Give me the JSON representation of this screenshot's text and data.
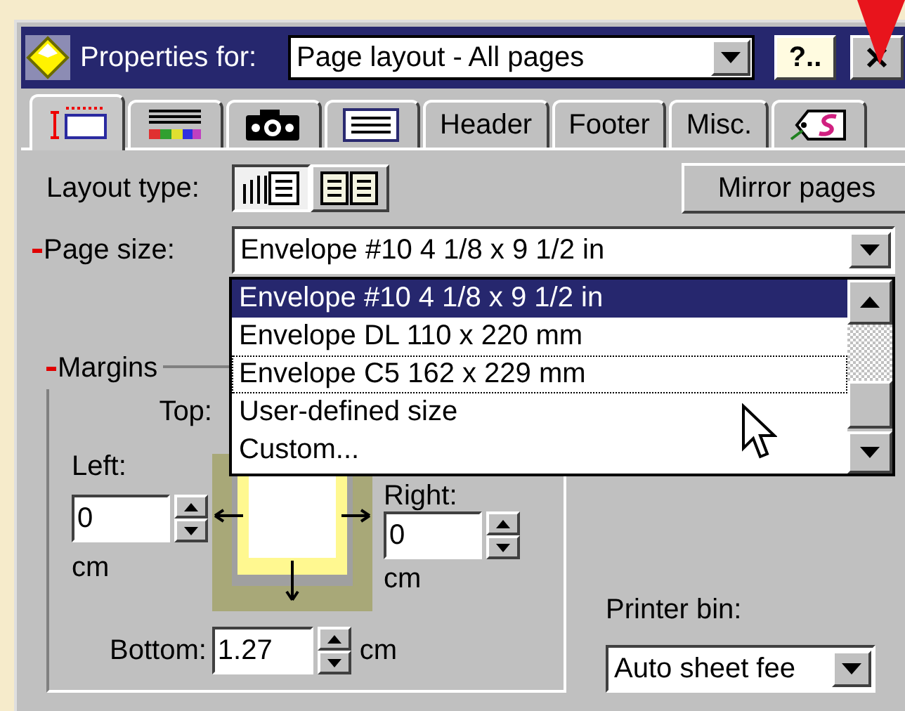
{
  "title_bar": {
    "label": "Properties for:",
    "selector": "Page layout - All pages",
    "help": "?.."
  },
  "tabs": [
    {
      "kind": "icon",
      "selected": true
    },
    {
      "kind": "icon",
      "selected": false
    },
    {
      "kind": "icon",
      "selected": false
    },
    {
      "kind": "icon",
      "selected": false
    },
    {
      "kind": "text",
      "label": "Header",
      "selected": false
    },
    {
      "kind": "text",
      "label": "Footer",
      "selected": false
    },
    {
      "kind": "text",
      "label": "Misc.",
      "selected": false
    },
    {
      "kind": "icon",
      "selected": false
    }
  ],
  "layout_type": {
    "label": "Layout type:",
    "options": [
      {
        "selected": true
      },
      {
        "selected": false
      }
    ]
  },
  "mirror_button": "Mirror pages",
  "page_size": {
    "label": "Page size:",
    "marked": true,
    "value": "Envelope #10 4 1/8 x 9 1/2 in",
    "options": [
      {
        "label": "Envelope #10 4 1/8 x 9 1/2 in",
        "selected": true,
        "focused": false
      },
      {
        "label": "Envelope DL 110 x 220 mm",
        "selected": false,
        "focused": false
      },
      {
        "label": "Envelope C5 162 x 229 mm",
        "selected": false,
        "focused": true
      },
      {
        "label": "User-defined size",
        "selected": false,
        "focused": false
      },
      {
        "label": "Custom...",
        "selected": false,
        "focused": false
      }
    ]
  },
  "margins": {
    "label": "Margins",
    "marked": true,
    "top": {
      "label": "Top:"
    },
    "left": {
      "label": "Left:",
      "value": "0",
      "unit": "cm"
    },
    "right": {
      "label": "Right:",
      "value": "0",
      "unit": "cm"
    },
    "bottom": {
      "label": "Bottom:",
      "value": "1.27",
      "unit": "cm"
    }
  },
  "printer_bin": {
    "label": "Printer bin:",
    "value": "Auto sheet fee"
  }
}
